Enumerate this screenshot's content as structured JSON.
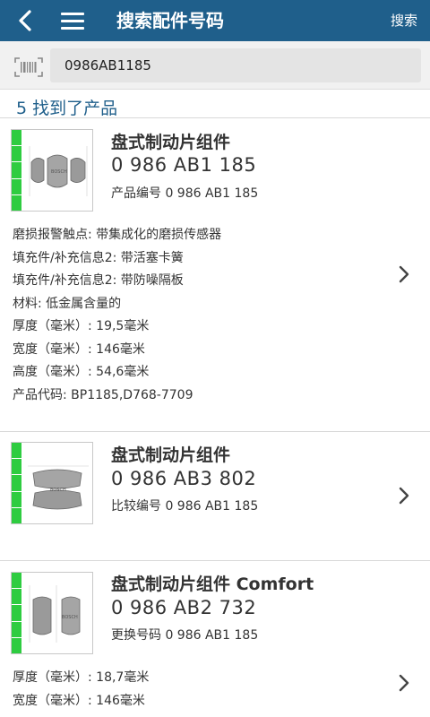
{
  "header": {
    "title": "搜索配件号码",
    "search_label": "搜索"
  },
  "search": {
    "value": "0986AB1185"
  },
  "results": {
    "count_text": "5 找到了产品"
  },
  "products": [
    {
      "name": "盘式制动片组件",
      "number": "0 986 AB1 185",
      "subline": "产品编号 0 986 AB1 185",
      "attributes": [
        "磨损报警触点: 带集成化的磨损传感器",
        "填充件/补充信息2: 带活塞卡簧",
        "填充件/补充信息2: 带防噪隔板",
        "材料: 低金属含量的",
        "厚度（毫米）: 19,5毫米",
        "宽度（毫米）: 146毫米",
        "高度（毫米）: 54,6毫米",
        "产品代码: BP1185,D768-7709"
      ]
    },
    {
      "name": "盘式制动片组件",
      "number": "0 986 AB3 802",
      "subline": "比较编号 0 986 AB1 185",
      "attributes": []
    },
    {
      "name": "盘式制动片组件 Comfort",
      "number": "0 986 AB2 732",
      "subline": "更换号码 0 986 AB1 185",
      "attributes": [
        "厚度（毫米）: 18,7毫米",
        "宽度（毫米）: 146毫米"
      ]
    }
  ],
  "colors": {
    "header_bg": "#1f5f8b",
    "accent_text": "#1f5f8b",
    "rating_green": "#2ecc40"
  },
  "icons": {
    "back": "chevron-left-icon",
    "menu": "hamburger-menu-icon",
    "barcode": "barcode-icon",
    "row_arrow": "chevron-right-icon"
  }
}
